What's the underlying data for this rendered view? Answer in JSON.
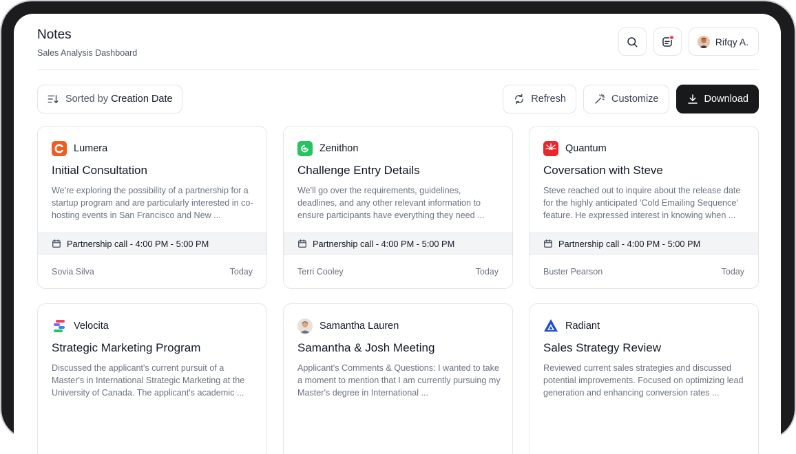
{
  "header": {
    "title": "Notes",
    "subtitle": "Sales Analysis Dashboard",
    "user_name": "Rifqy A."
  },
  "toolbar": {
    "sort_prefix": "Sorted by",
    "sort_value": "Creation Date",
    "refresh_label": "Refresh",
    "customize_label": "Customize",
    "download_label": "Download"
  },
  "colors": {
    "accent_dark": "#18191b",
    "notification": "#ef4444"
  },
  "cards": [
    {
      "brand": "Lumera",
      "brand_icon": "lumera-logo",
      "title": "Initial Consultation",
      "description": "We're exploring the possibility of a partnership for a startup program and are particularly interested in co-hosting events in San Francisco and New ...",
      "event": "Partnership call - 4:00 PM - 5:00 PM",
      "author": "Sovia Silva",
      "date": "Today"
    },
    {
      "brand": "Zenithon",
      "brand_icon": "zenithon-logo",
      "title": "Challenge Entry Details",
      "description": "We'll go over the requirements, guidelines, deadlines, and any other relevant information to ensure participants have everything they need ...",
      "event": "Partnership call - 4:00 PM - 5:00 PM",
      "author": "Terri Cooley",
      "date": "Today"
    },
    {
      "brand": "Quantum",
      "brand_icon": "quantum-logo",
      "title": "Coversation with Steve",
      "description": "Steve reached out to inquire about the release date for the highly anticipated 'Cold Emailing Sequence' feature. He expressed interest in knowing when ...",
      "event": "Partnership call - 4:00 PM - 5:00 PM",
      "author": "Buster Pearson",
      "date": "Today"
    },
    {
      "brand": "Velocita",
      "brand_icon": "velocita-logo",
      "title": "Strategic Marketing Program",
      "description": "Discussed the applicant's current pursuit of a Master's in International Strategic Marketing at the University of Canada. The applicant's academic ..."
    },
    {
      "brand": "Samantha Lauren",
      "brand_icon": "person-avatar",
      "title": "Samantha & Josh Meeting",
      "description": "Applicant's Comments & Questions: I wanted to take a moment to mention that I am currently pursuing my Master's degree in International ..."
    },
    {
      "brand": "Radiant",
      "brand_icon": "radiant-logo",
      "title": "Sales Strategy Review",
      "description": "Reviewed current sales strategies and discussed potential improvements. Focused on optimizing lead generation and enhancing conversion rates ..."
    }
  ]
}
